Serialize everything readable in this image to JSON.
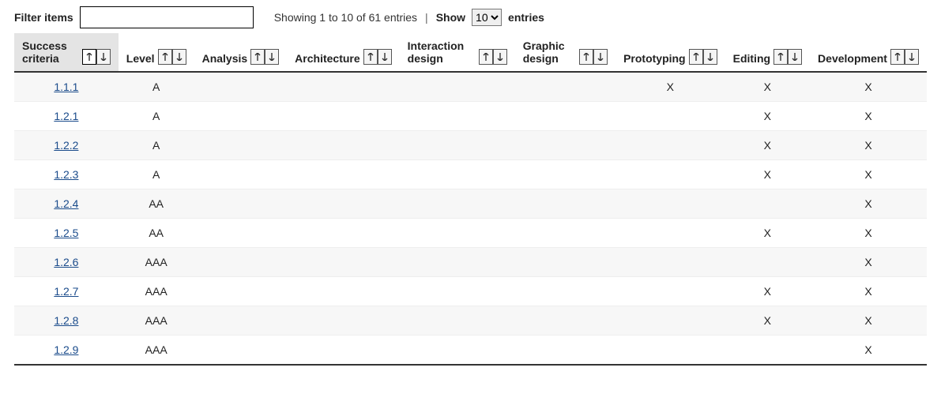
{
  "toolbar": {
    "filter_label": "Filter items",
    "filter_value": "",
    "showing_text": "Showing 1 to 10 of 61 entries",
    "show_label": "Show",
    "show_value": "10",
    "show_options": [
      "10"
    ],
    "entries_suffix": "entries"
  },
  "columns": [
    {
      "key": "criteria",
      "label": "Success criteria",
      "sorted": "asc"
    },
    {
      "key": "level",
      "label": "Level",
      "sorted": null
    },
    {
      "key": "analysis",
      "label": "Analysis",
      "sorted": null
    },
    {
      "key": "architecture",
      "label": "Architecture",
      "sorted": null
    },
    {
      "key": "interaction",
      "label": "Interaction design",
      "sorted": null
    },
    {
      "key": "graphic",
      "label": "Graphic design",
      "sorted": null
    },
    {
      "key": "prototyping",
      "label": "Prototyping",
      "sorted": null
    },
    {
      "key": "editing",
      "label": "Editing",
      "sorted": null
    },
    {
      "key": "development",
      "label": "Development",
      "sorted": null
    }
  ],
  "rows": [
    {
      "criteria": "1.1.1",
      "level": "A",
      "analysis": "",
      "architecture": "",
      "interaction": "",
      "graphic": "",
      "prototyping": "X",
      "editing": "X",
      "development": "X"
    },
    {
      "criteria": "1.2.1",
      "level": "A",
      "analysis": "",
      "architecture": "",
      "interaction": "",
      "graphic": "",
      "prototyping": "",
      "editing": "X",
      "development": "X"
    },
    {
      "criteria": "1.2.2",
      "level": "A",
      "analysis": "",
      "architecture": "",
      "interaction": "",
      "graphic": "",
      "prototyping": "",
      "editing": "X",
      "development": "X"
    },
    {
      "criteria": "1.2.3",
      "level": "A",
      "analysis": "",
      "architecture": "",
      "interaction": "",
      "graphic": "",
      "prototyping": "",
      "editing": "X",
      "development": "X"
    },
    {
      "criteria": "1.2.4",
      "level": "AA",
      "analysis": "",
      "architecture": "",
      "interaction": "",
      "graphic": "",
      "prototyping": "",
      "editing": "",
      "development": "X"
    },
    {
      "criteria": "1.2.5",
      "level": "AA",
      "analysis": "",
      "architecture": "",
      "interaction": "",
      "graphic": "",
      "prototyping": "",
      "editing": "X",
      "development": "X"
    },
    {
      "criteria": "1.2.6",
      "level": "AAA",
      "analysis": "",
      "architecture": "",
      "interaction": "",
      "graphic": "",
      "prototyping": "",
      "editing": "",
      "development": "X"
    },
    {
      "criteria": "1.2.7",
      "level": "AAA",
      "analysis": "",
      "architecture": "",
      "interaction": "",
      "graphic": "",
      "prototyping": "",
      "editing": "X",
      "development": "X"
    },
    {
      "criteria": "1.2.8",
      "level": "AAA",
      "analysis": "",
      "architecture": "",
      "interaction": "",
      "graphic": "",
      "prototyping": "",
      "editing": "X",
      "development": "X"
    },
    {
      "criteria": "1.2.9",
      "level": "AAA",
      "analysis": "",
      "architecture": "",
      "interaction": "",
      "graphic": "",
      "prototyping": "",
      "editing": "",
      "development": "X"
    }
  ]
}
